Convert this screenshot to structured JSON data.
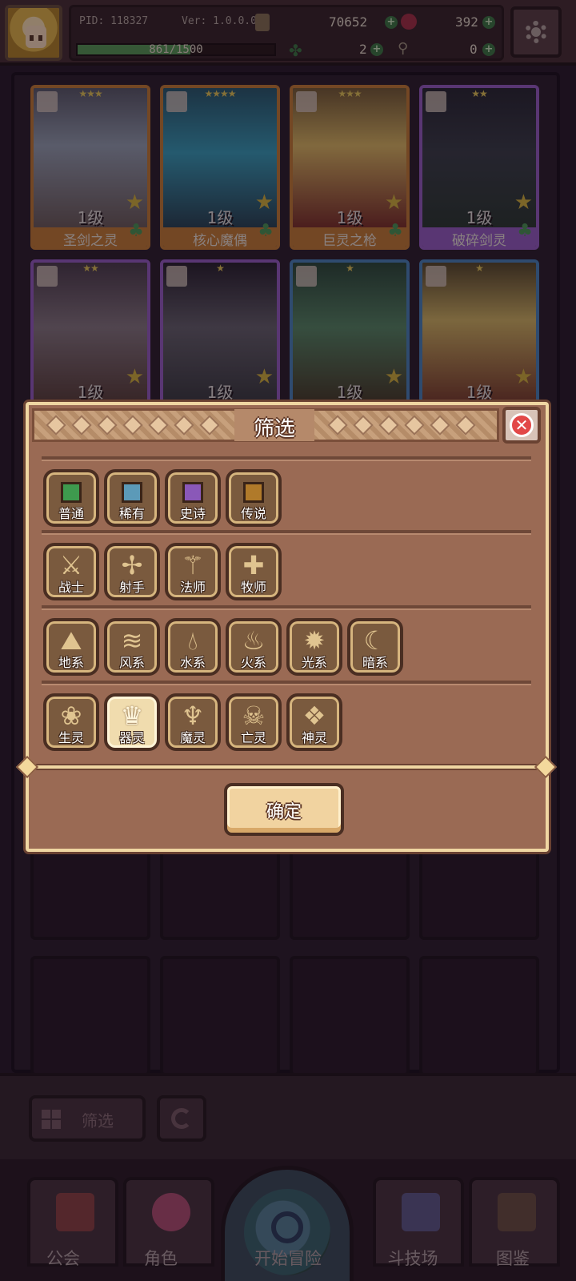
{
  "header": {
    "pid_label": "PID: 118327",
    "version_label": "Ver: 1.0.0.0",
    "gold": "70652",
    "gems": "392",
    "clover": "2",
    "keys": "0",
    "exp_text": "861/1500",
    "exp_progress": 0.574
  },
  "roster": {
    "cards": [
      {
        "name": "圣剑之灵",
        "level": "1级",
        "stars": "★★★",
        "rarity": "orange"
      },
      {
        "name": "核心魔偶",
        "level": "1级",
        "stars": "★★★★",
        "rarity": "orange"
      },
      {
        "name": "巨灵之枪",
        "level": "1级",
        "stars": "★★★",
        "rarity": "orange"
      },
      {
        "name": "破碎剑灵",
        "level": "1级",
        "stars": "★★",
        "rarity": "purple"
      },
      {
        "name": "",
        "level": "1级",
        "stars": "★★",
        "rarity": "purple"
      },
      {
        "name": "",
        "level": "1级",
        "stars": "★",
        "rarity": "purple"
      },
      {
        "name": "",
        "level": "1级",
        "stars": "★",
        "rarity": "blue"
      },
      {
        "name": "",
        "level": "1级",
        "stars": "★",
        "rarity": "blue"
      }
    ]
  },
  "modal": {
    "title": "筛选",
    "rarity": [
      "普通",
      "稀有",
      "史诗",
      "传说"
    ],
    "rarity_colors": [
      "#3e9a4e",
      "#5c9ab8",
      "#8a58b8",
      "#b07a2a"
    ],
    "class": [
      "战士",
      "射手",
      "法师",
      "牧师"
    ],
    "element": [
      "地系",
      "风系",
      "水系",
      "火系",
      "光系",
      "暗系"
    ],
    "race": [
      "生灵",
      "器灵",
      "魔灵",
      "亡灵",
      "神灵"
    ],
    "selected_race": "器灵",
    "confirm": "确定"
  },
  "controls": {
    "filter_label": "筛选"
  },
  "nav": {
    "guild": "公会",
    "role": "角色",
    "adventure": "开始冒险",
    "arena": "斗技场",
    "codex": "图鉴"
  }
}
